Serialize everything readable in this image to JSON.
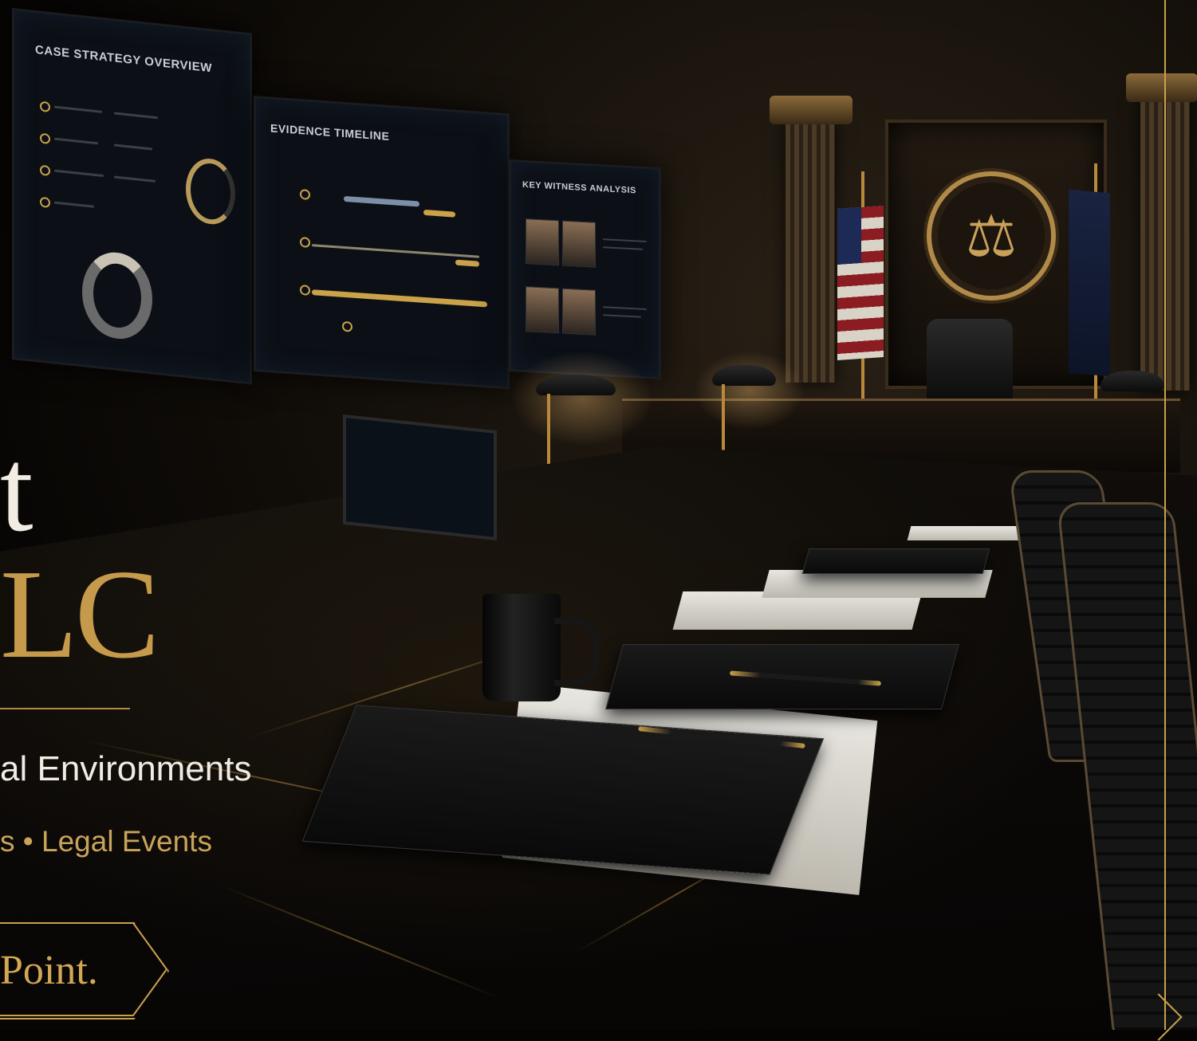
{
  "screens": {
    "case_strategy_title": "CASE STRATEGY OVERVIEW",
    "evidence_timeline_title": "EVIDENCE TIMELINE",
    "key_witness_title": "KEY WITNESS ANALYSIS"
  },
  "hero": {
    "headline_fragment_1": "t",
    "headline_fragment_2": "LC",
    "tagline": "al Environments",
    "services": "s  •  Legal Events",
    "cta_label": "Point."
  },
  "colors": {
    "gold": "#c9a24a",
    "ivory": "#f2ede4",
    "background": "#050403"
  }
}
